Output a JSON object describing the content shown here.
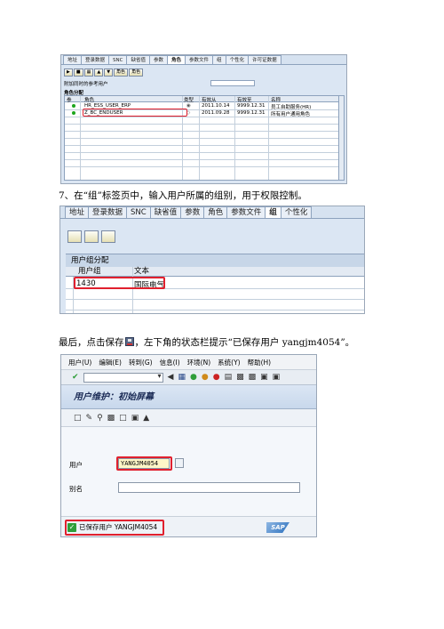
{
  "screenshot1": {
    "tabs": [
      "地址",
      "登录数据",
      "SNC",
      "缺省值",
      "参数",
      "角色",
      "参数文件",
      "组",
      "个性化",
      "许可证数据"
    ],
    "active_tab": "角色",
    "toolbar": [
      "角色",
      "角色"
    ],
    "filter_label": "附加同时的参考用户",
    "section_title": "角色分配",
    "columns": [
      "参",
      "角色",
      "类型",
      "有效从",
      "有效至",
      "名称"
    ],
    "rows": [
      {
        "role": "HR_ESS_USER_ERP",
        "from": "2011.10.14",
        "to": "9999.12.31",
        "name": "员工自助服务(HR)"
      },
      {
        "role": "Z_BC_ENDUSER",
        "from": "2011.09.28",
        "to": "9999.12.31",
        "name": "所有用户通用角色"
      }
    ]
  },
  "caption1": "7、在“组”标签页中，输入用户所属的组别，用于权限控制。",
  "screenshot2": {
    "tabs": [
      "地址",
      "登录数据",
      "SNC",
      "缺省值",
      "参数",
      "角色",
      "参数文件",
      "组",
      "个性化"
    ],
    "active_tab": "组",
    "section_title": "用户组分配",
    "col_group": "用户组",
    "col_text": "文本",
    "row_group": "1430",
    "row_text": "国际电气"
  },
  "caption2_before": "最后，点击保存",
  "caption2_after": "，左下角的状态栏提示“已保存用户 yangjm4054”。",
  "screenshot3": {
    "menu": [
      "用户(U)",
      "编辑(E)",
      "转到(G)",
      "信息(I)",
      "环境(N)",
      "系统(Y)",
      "帮助(H)"
    ],
    "title": "用户维护：初始屏幕",
    "user_label": "用户",
    "user_value": "YANGJM4054",
    "alias_label": "别名",
    "status_text": "已保存用户 YANGJM4054",
    "logo": "SAP"
  },
  "colors": {
    "highlight": "#e0202e",
    "sap_blue": "#2a6fbd",
    "success_green": "#2f9e3a"
  }
}
